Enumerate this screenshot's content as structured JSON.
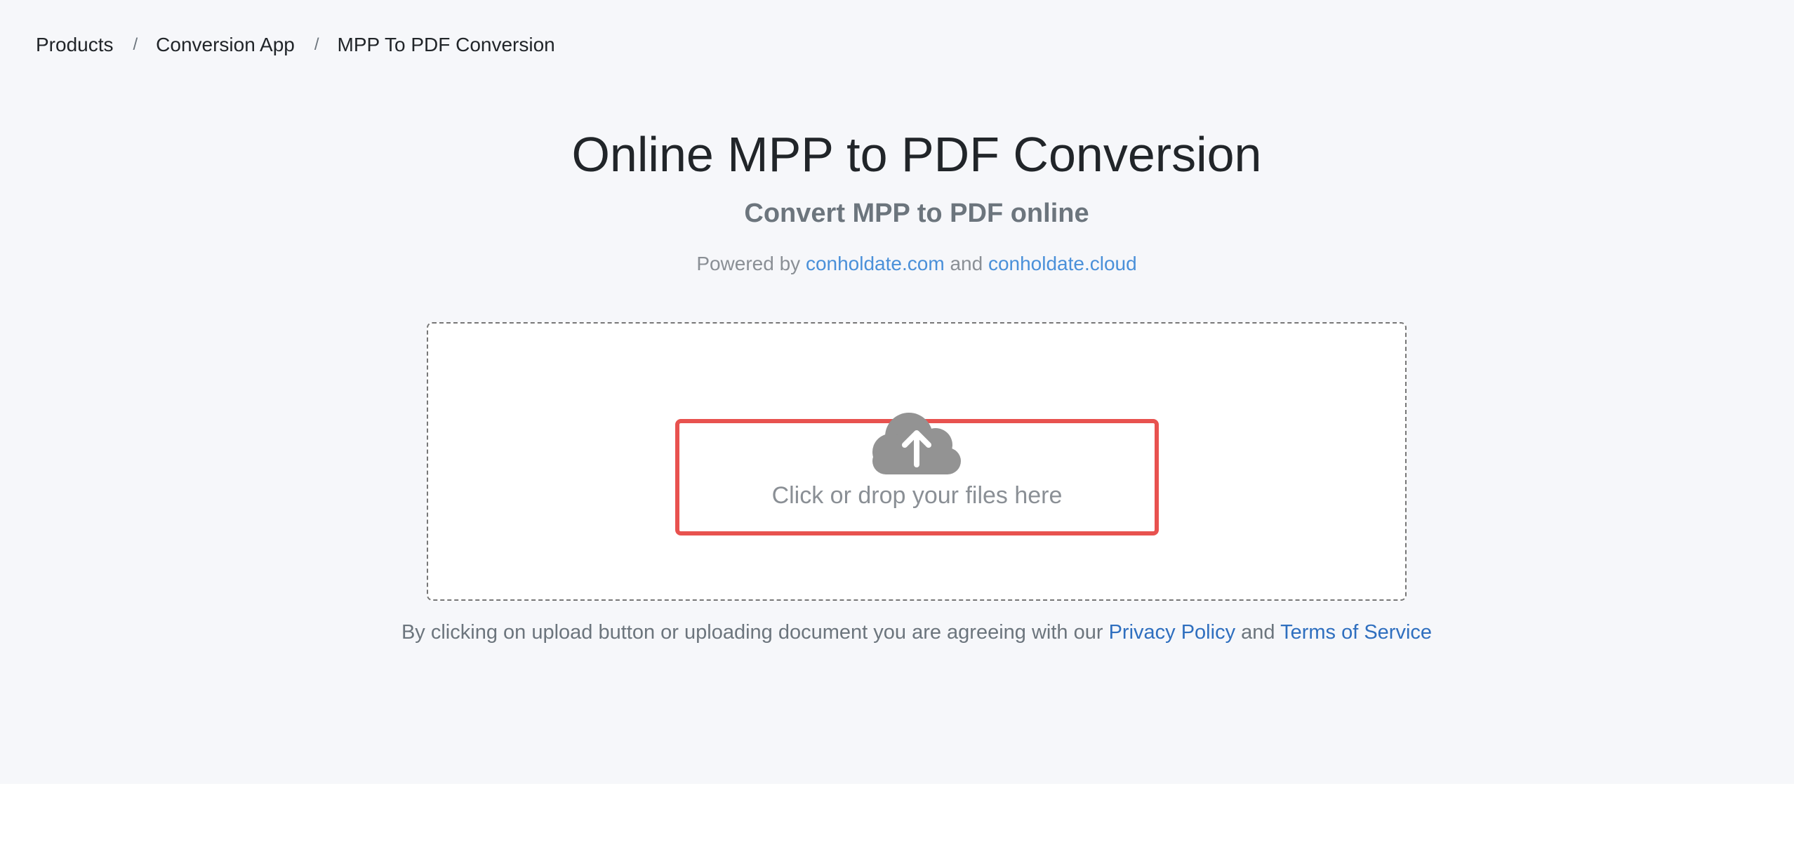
{
  "breadcrumb": {
    "items": [
      "Products",
      "Conversion App"
    ],
    "separator": "/",
    "current": "MPP To PDF Conversion"
  },
  "header": {
    "title": "Online MPP to PDF Conversion",
    "subtitle": "Convert MPP to PDF online",
    "powered_prefix": "Powered by",
    "powered_link1": "conholdate.com",
    "powered_and": "and",
    "powered_link2": "conholdate.cloud"
  },
  "upload": {
    "label": "Click or drop your files here",
    "icon": "cloud-upload-icon"
  },
  "agreement": {
    "prefix": "By clicking on upload button or uploading document you are agreeing with our",
    "privacy_link": "Privacy Policy",
    "and": "and",
    "terms_link": "Terms of Service"
  },
  "colors": {
    "hero_bg": "#f6f7fa",
    "link": "#4a90d9",
    "link_dark": "#2f6fbf",
    "highlight_border": "#e8524f",
    "icon_gray": "#939393"
  }
}
